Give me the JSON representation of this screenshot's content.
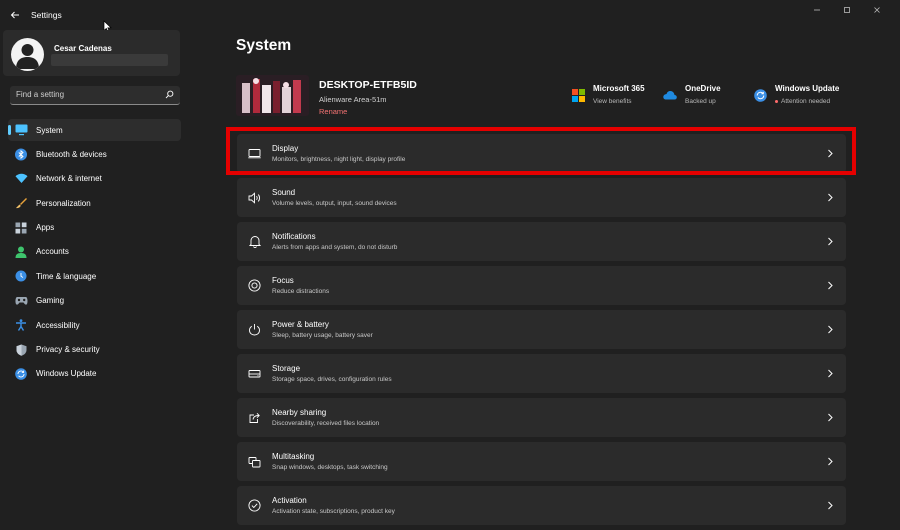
{
  "app": {
    "title": "Settings"
  },
  "user": {
    "name": "Cesar Cadenas"
  },
  "search": {
    "placeholder": "Find a setting"
  },
  "nav": {
    "items": [
      {
        "label": "System",
        "active": true,
        "icon": "monitor-icon",
        "color": "#4cc2ff"
      },
      {
        "label": "Bluetooth & devices",
        "icon": "bluetooth-icon",
        "color": "#3b8fe5"
      },
      {
        "label": "Network & internet",
        "icon": "wifi-icon",
        "color": "#4cc2ff"
      },
      {
        "label": "Personalization",
        "icon": "brush-icon",
        "color": "#e8a23a"
      },
      {
        "label": "Apps",
        "icon": "apps-icon",
        "color": "#9aa6b2"
      },
      {
        "label": "Accounts",
        "icon": "person-icon",
        "color": "#3ec46d"
      },
      {
        "label": "Time & language",
        "icon": "globe-clock-icon",
        "color": "#3b8fe5"
      },
      {
        "label": "Gaming",
        "icon": "gamepad-icon",
        "color": "#9aa6b2"
      },
      {
        "label": "Accessibility",
        "icon": "accessibility-icon",
        "color": "#3b8fe5"
      },
      {
        "label": "Privacy & security",
        "icon": "shield-icon",
        "color": "#9aa6b2"
      },
      {
        "label": "Windows Update",
        "icon": "update-icon",
        "color": "#3b8fe5"
      }
    ]
  },
  "main": {
    "title": "System",
    "device": {
      "name": "DESKTOP-ETFB5ID",
      "model": "Alienware Area-51m",
      "rename": "Rename"
    },
    "quick": [
      {
        "title": "Microsoft 365",
        "sub": "View benefits",
        "icon": "microsoft-logo-icon"
      },
      {
        "title": "OneDrive",
        "sub": "Backed up",
        "icon": "onedrive-cloud-icon"
      },
      {
        "title": "Windows Update",
        "sub": "Attention needed",
        "icon": "windows-update-icon",
        "alert": true
      }
    ],
    "cards": [
      {
        "title": "Display",
        "sub": "Monitors, brightness, night light, display profile",
        "icon": "display-icon"
      },
      {
        "title": "Sound",
        "sub": "Volume levels, output, input, sound devices",
        "icon": "speaker-icon"
      },
      {
        "title": "Notifications",
        "sub": "Alerts from apps and system, do not disturb",
        "icon": "bell-icon"
      },
      {
        "title": "Focus",
        "sub": "Reduce distractions",
        "icon": "focus-icon"
      },
      {
        "title": "Power & battery",
        "sub": "Sleep, battery usage, battery saver",
        "icon": "power-icon"
      },
      {
        "title": "Storage",
        "sub": "Storage space, drives, configuration rules",
        "icon": "storage-icon"
      },
      {
        "title": "Nearby sharing",
        "sub": "Discoverability, received files location",
        "icon": "share-icon"
      },
      {
        "title": "Multitasking",
        "sub": "Snap windows, desktops, task switching",
        "icon": "multitasking-icon"
      },
      {
        "title": "Activation",
        "sub": "Activation state, subscriptions, product key",
        "icon": "activation-check-icon"
      }
    ]
  },
  "colors": {
    "accent": "#60cdff",
    "highlight": "#e50000",
    "background": "#202020",
    "card": "#2b2b2b",
    "rename": "#f37272"
  }
}
